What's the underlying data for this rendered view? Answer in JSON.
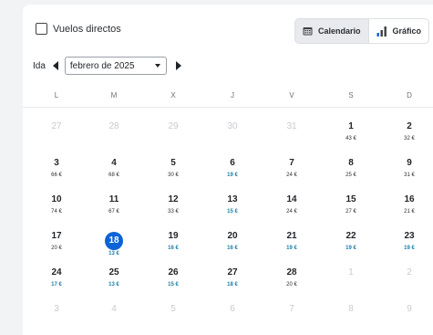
{
  "filters": {
    "direct_flights_label": "Vuelos directos"
  },
  "view_toggle": {
    "calendar_label": "Calendario",
    "chart_label": "Gráfico",
    "active": "calendar"
  },
  "month_nav": {
    "direction_label": "Ida",
    "selected_month": "febrero de 2025"
  },
  "weekdays": [
    "L",
    "M",
    "X",
    "J",
    "V",
    "S",
    "D"
  ],
  "accent_colors": {
    "selected": "#0b63d6",
    "cheap_price": "#1a7fa8"
  },
  "selected_day": "18",
  "weeks": [
    [
      {
        "day": "27",
        "muted": true
      },
      {
        "day": "28",
        "muted": true
      },
      {
        "day": "29",
        "muted": true
      },
      {
        "day": "30",
        "muted": true
      },
      {
        "day": "31",
        "muted": true
      },
      {
        "day": "1",
        "price": "43 €"
      },
      {
        "day": "2",
        "price": "32 €"
      }
    ],
    [
      {
        "day": "3",
        "price": "66 €"
      },
      {
        "day": "4",
        "price": "68 €"
      },
      {
        "day": "5",
        "price": "30 €"
      },
      {
        "day": "6",
        "price": "19 €",
        "cheap": true
      },
      {
        "day": "7",
        "price": "24 €"
      },
      {
        "day": "8",
        "price": "25 €"
      },
      {
        "day": "9",
        "price": "31 €"
      }
    ],
    [
      {
        "day": "10",
        "price": "74 €"
      },
      {
        "day": "11",
        "price": "67 €"
      },
      {
        "day": "12",
        "price": "33 €"
      },
      {
        "day": "13",
        "price": "15 €",
        "cheap": true
      },
      {
        "day": "14",
        "price": "24 €"
      },
      {
        "day": "15",
        "price": "27 €"
      },
      {
        "day": "16",
        "price": "21 €"
      }
    ],
    [
      {
        "day": "17",
        "price": "20 €"
      },
      {
        "day": "18",
        "price": "13 €",
        "cheap": true,
        "selected": true
      },
      {
        "day": "19",
        "price": "16 €",
        "cheap": true
      },
      {
        "day": "20",
        "price": "16 €",
        "cheap": true
      },
      {
        "day": "21",
        "price": "19 €",
        "cheap": true
      },
      {
        "day": "22",
        "price": "19 €",
        "cheap": true
      },
      {
        "day": "23",
        "price": "19 €",
        "cheap": true
      }
    ],
    [
      {
        "day": "24",
        "price": "17 €",
        "cheap": true
      },
      {
        "day": "25",
        "price": "13 €",
        "cheap": true
      },
      {
        "day": "26",
        "price": "15 €",
        "cheap": true
      },
      {
        "day": "27",
        "price": "18 €",
        "cheap": true
      },
      {
        "day": "28",
        "price": "20 €"
      },
      {
        "day": "1",
        "muted": true
      },
      {
        "day": "2",
        "muted": true
      }
    ],
    [
      {
        "day": "3",
        "muted": true
      },
      {
        "day": "4",
        "muted": true
      },
      {
        "day": "5",
        "muted": true
      },
      {
        "day": "6",
        "muted": true
      },
      {
        "day": "7",
        "muted": true
      },
      {
        "day": "8",
        "muted": true
      },
      {
        "day": "9",
        "muted": true
      }
    ]
  ]
}
